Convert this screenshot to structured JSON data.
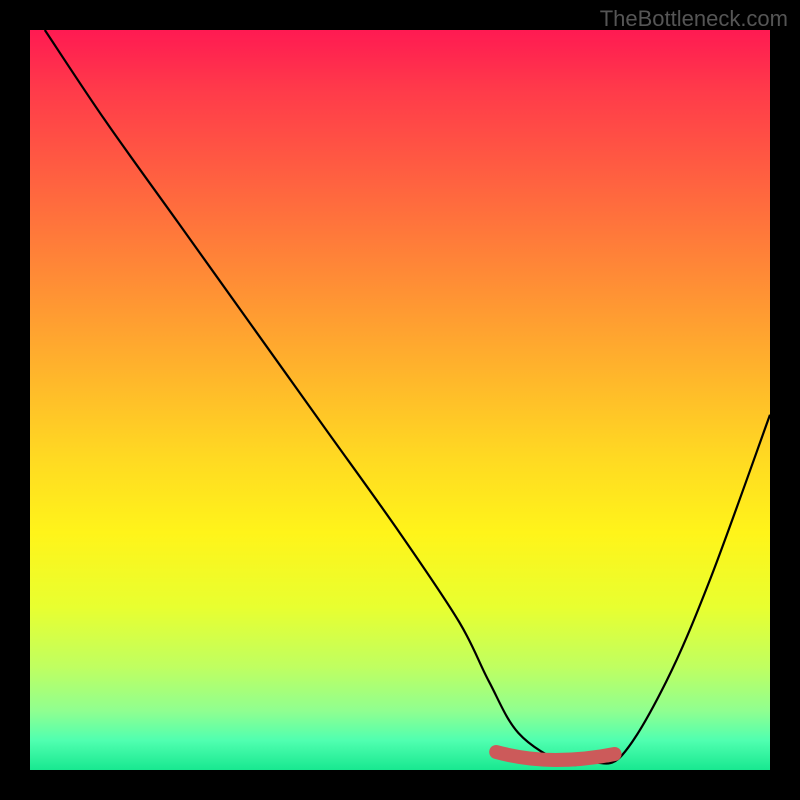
{
  "watermark": "TheBottleneck.com",
  "chart_data": {
    "type": "line",
    "title": "",
    "xlabel": "",
    "ylabel": "",
    "xlim": [
      0,
      100
    ],
    "ylim": [
      0,
      100
    ],
    "grid": false,
    "series": [
      {
        "name": "bottleneck-curve",
        "x": [
          2,
          10,
          20,
          30,
          40,
          50,
          58,
          62,
          66,
          72,
          76,
          80,
          86,
          92,
          100
        ],
        "values": [
          100,
          88,
          74,
          60,
          46,
          32,
          20,
          12,
          5,
          1,
          1,
          2,
          12,
          26,
          48
        ]
      }
    ],
    "optimal_range": {
      "x_start": 63,
      "x_end": 79
    },
    "gradient": {
      "top_color": "#ff1a52",
      "bottom_color": "#18e890"
    }
  }
}
